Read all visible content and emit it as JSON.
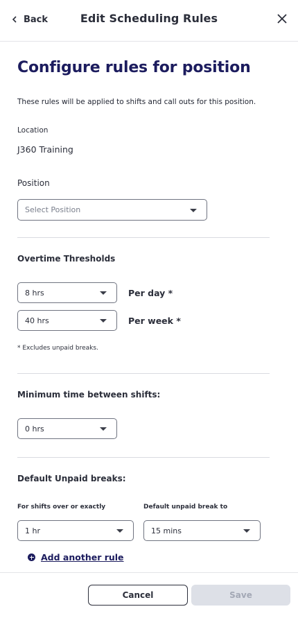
{
  "header": {
    "back_label": "Back",
    "title": "Edit Scheduling Rules"
  },
  "main": {
    "title": "Configure rules for position",
    "description": "These rules will be applied to shifts and call outs for this position.",
    "location": {
      "label": "Location",
      "value": "J360 Training"
    },
    "position": {
      "label": "Position",
      "placeholder": "Select Position"
    },
    "overtime": {
      "heading": "Overtime Thresholds",
      "per_day": {
        "value": "8 hrs",
        "label": "Per day *"
      },
      "per_week": {
        "value": "40 hrs",
        "label": "Per week *"
      },
      "footnote": "* Excludes unpaid breaks."
    },
    "min_time": {
      "heading": "Minimum time between shifts:",
      "value": "0 hrs"
    },
    "unpaid_breaks": {
      "heading": "Default Unpaid breaks:",
      "col1_label": "For shifts over or exactly",
      "col2_label": "Default unpaid break to",
      "col1_value": "1 hr",
      "col2_value": "15 mins",
      "add_rule_label": "Add another rule"
    }
  },
  "footer": {
    "cancel_label": "Cancel",
    "save_label": "Save"
  },
  "colors": {
    "accent": "#1c1c5e",
    "disabled_bg": "#dde0e7",
    "disabled_text": "#a3a8b5"
  },
  "icons": {
    "back": "chevron-left-icon",
    "close": "close-icon",
    "add": "plus-circle-icon",
    "dropdown": "caret-down-icon"
  }
}
